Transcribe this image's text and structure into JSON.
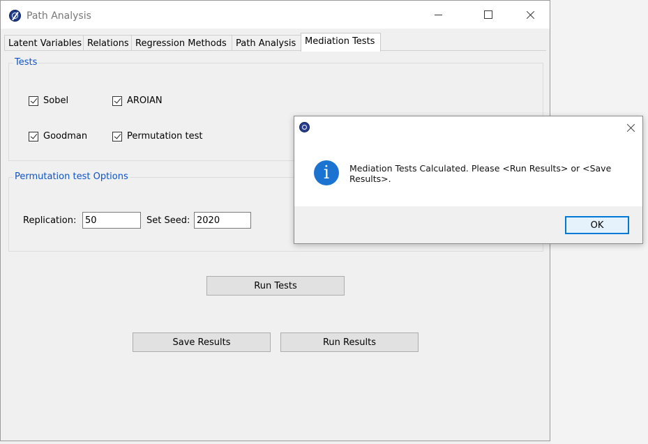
{
  "window": {
    "title": "Path Analysis"
  },
  "tabs": [
    {
      "label": "Latent Variables"
    },
    {
      "label": "Relations"
    },
    {
      "label": "Regression Methods"
    },
    {
      "label": "Path Analysis"
    },
    {
      "label": "Mediation Tests",
      "active": true
    }
  ],
  "tests_group": {
    "title": "Tests",
    "checkboxes": [
      {
        "label": "Sobel",
        "checked": true
      },
      {
        "label": "AROIAN",
        "checked": true
      },
      {
        "label": "Goodman",
        "checked": true
      },
      {
        "label": "Permutation test",
        "checked": true
      }
    ]
  },
  "permutation_group": {
    "title": "Permutation test Options",
    "replication_label": "Replication:",
    "replication_value": "50",
    "seed_label": "Set Seed:",
    "seed_value": "2020"
  },
  "buttons": {
    "run_tests": "Run Tests",
    "save_results": "Save Results",
    "run_results": "Run Results"
  },
  "dialog": {
    "title": "",
    "message": "Mediation Tests Calculated. Please <Run Results> or <Save Results>.",
    "ok_label": "OK",
    "icon": "info-icon"
  },
  "colors": {
    "group_title": "#0d53c7",
    "info_icon": "#1a73d1",
    "ok_border": "#0078d7"
  }
}
